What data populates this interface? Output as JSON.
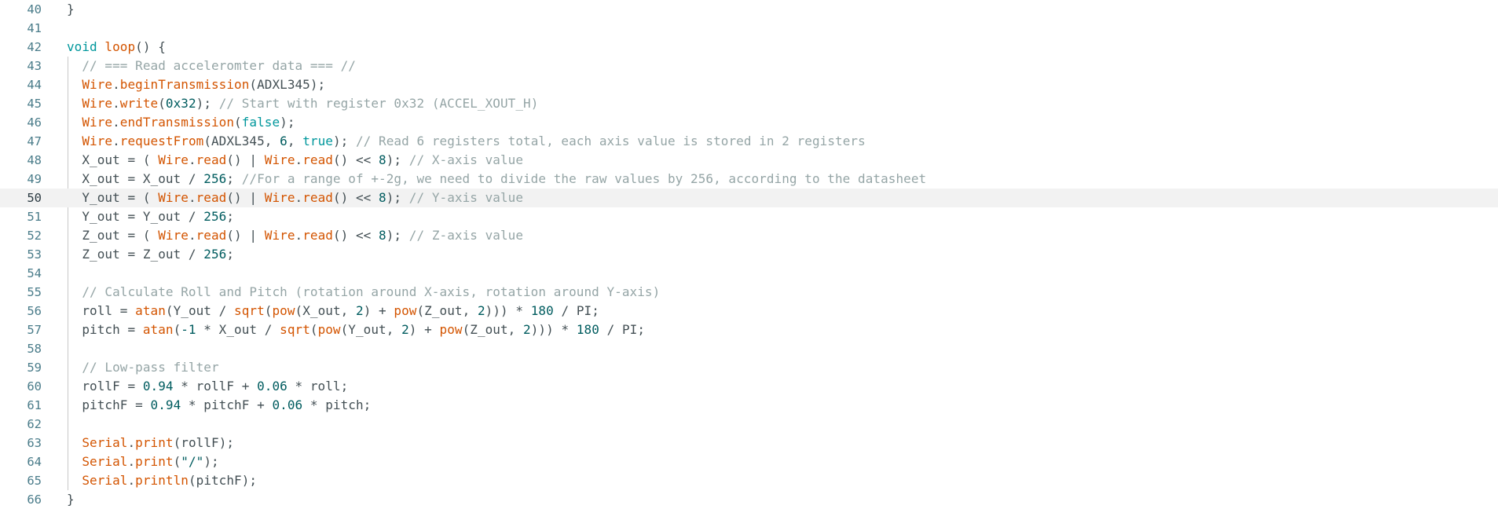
{
  "editor": {
    "active_line": 50,
    "lines": [
      {
        "n": "40",
        "tokens": [
          [
            "txt",
            "}"
          ]
        ]
      },
      {
        "n": "41",
        "tokens": []
      },
      {
        "n": "42",
        "tokens": [
          [
            "kw",
            "void"
          ],
          [
            "txt",
            " "
          ],
          [
            "fn",
            "loop"
          ],
          [
            "txt",
            "() {"
          ]
        ]
      },
      {
        "n": "43",
        "tokens": [
          [
            "txt",
            "  "
          ],
          [
            "com",
            "// === Read acceleromter data === //"
          ]
        ]
      },
      {
        "n": "44",
        "tokens": [
          [
            "txt",
            "  "
          ],
          [
            "obj",
            "Wire"
          ],
          [
            "txt",
            "."
          ],
          [
            "fn",
            "beginTransmission"
          ],
          [
            "txt",
            "(ADXL345);"
          ]
        ]
      },
      {
        "n": "45",
        "tokens": [
          [
            "txt",
            "  "
          ],
          [
            "obj",
            "Wire"
          ],
          [
            "txt",
            "."
          ],
          [
            "fn",
            "write"
          ],
          [
            "txt",
            "("
          ],
          [
            "num",
            "0x32"
          ],
          [
            "txt",
            "); "
          ],
          [
            "com",
            "// Start with register 0x32 (ACCEL_XOUT_H)"
          ]
        ]
      },
      {
        "n": "46",
        "tokens": [
          [
            "txt",
            "  "
          ],
          [
            "obj",
            "Wire"
          ],
          [
            "txt",
            "."
          ],
          [
            "fn",
            "endTransmission"
          ],
          [
            "txt",
            "("
          ],
          [
            "kw",
            "false"
          ],
          [
            "txt",
            ");"
          ]
        ]
      },
      {
        "n": "47",
        "tokens": [
          [
            "txt",
            "  "
          ],
          [
            "obj",
            "Wire"
          ],
          [
            "txt",
            "."
          ],
          [
            "fn",
            "requestFrom"
          ],
          [
            "txt",
            "(ADXL345, "
          ],
          [
            "num",
            "6"
          ],
          [
            "txt",
            ", "
          ],
          [
            "kw",
            "true"
          ],
          [
            "txt",
            "); "
          ],
          [
            "com",
            "// Read 6 registers total, each axis value is stored in 2 registers"
          ]
        ]
      },
      {
        "n": "48",
        "tokens": [
          [
            "txt",
            "  X_out = ( "
          ],
          [
            "obj",
            "Wire"
          ],
          [
            "txt",
            "."
          ],
          [
            "fn",
            "read"
          ],
          [
            "txt",
            "() | "
          ],
          [
            "obj",
            "Wire"
          ],
          [
            "txt",
            "."
          ],
          [
            "fn",
            "read"
          ],
          [
            "txt",
            "() << "
          ],
          [
            "num",
            "8"
          ],
          [
            "txt",
            "); "
          ],
          [
            "com",
            "// X-axis value"
          ]
        ]
      },
      {
        "n": "49",
        "tokens": [
          [
            "txt",
            "  X_out = X_out / "
          ],
          [
            "num",
            "256"
          ],
          [
            "txt",
            "; "
          ],
          [
            "com",
            "//For a range of +-2g, we need to divide the raw values by 256, according to the datasheet"
          ]
        ]
      },
      {
        "n": "50",
        "tokens": [
          [
            "txt",
            "  Y_out = ( "
          ],
          [
            "obj",
            "Wire"
          ],
          [
            "txt",
            "."
          ],
          [
            "fn",
            "read"
          ],
          [
            "txt",
            "() | "
          ],
          [
            "obj",
            "Wire"
          ],
          [
            "txt",
            "."
          ],
          [
            "fn",
            "read"
          ],
          [
            "txt",
            "() << "
          ],
          [
            "num",
            "8"
          ],
          [
            "txt",
            "); "
          ],
          [
            "com",
            "// Y-axis value"
          ]
        ]
      },
      {
        "n": "51",
        "tokens": [
          [
            "txt",
            "  Y_out = Y_out / "
          ],
          [
            "num",
            "256"
          ],
          [
            "txt",
            ";"
          ]
        ]
      },
      {
        "n": "52",
        "tokens": [
          [
            "txt",
            "  Z_out = ( "
          ],
          [
            "obj",
            "Wire"
          ],
          [
            "txt",
            "."
          ],
          [
            "fn",
            "read"
          ],
          [
            "txt",
            "() | "
          ],
          [
            "obj",
            "Wire"
          ],
          [
            "txt",
            "."
          ],
          [
            "fn",
            "read"
          ],
          [
            "txt",
            "() << "
          ],
          [
            "num",
            "8"
          ],
          [
            "txt",
            "); "
          ],
          [
            "com",
            "// Z-axis value"
          ]
        ]
      },
      {
        "n": "53",
        "tokens": [
          [
            "txt",
            "  Z_out = Z_out / "
          ],
          [
            "num",
            "256"
          ],
          [
            "txt",
            ";"
          ]
        ]
      },
      {
        "n": "54",
        "tokens": []
      },
      {
        "n": "55",
        "tokens": [
          [
            "txt",
            "  "
          ],
          [
            "com",
            "// Calculate Roll and Pitch (rotation around X-axis, rotation around Y-axis)"
          ]
        ]
      },
      {
        "n": "56",
        "tokens": [
          [
            "txt",
            "  roll = "
          ],
          [
            "fn",
            "atan"
          ],
          [
            "txt",
            "(Y_out / "
          ],
          [
            "fn",
            "sqrt"
          ],
          [
            "txt",
            "("
          ],
          [
            "fn",
            "pow"
          ],
          [
            "txt",
            "(X_out, "
          ],
          [
            "num",
            "2"
          ],
          [
            "txt",
            ") + "
          ],
          [
            "fn",
            "pow"
          ],
          [
            "txt",
            "(Z_out, "
          ],
          [
            "num",
            "2"
          ],
          [
            "txt",
            "))) * "
          ],
          [
            "num",
            "180"
          ],
          [
            "txt",
            " / PI;"
          ]
        ]
      },
      {
        "n": "57",
        "tokens": [
          [
            "txt",
            "  pitch = "
          ],
          [
            "fn",
            "atan"
          ],
          [
            "txt",
            "("
          ],
          [
            "num",
            "-1"
          ],
          [
            "txt",
            " * X_out / "
          ],
          [
            "fn",
            "sqrt"
          ],
          [
            "txt",
            "("
          ],
          [
            "fn",
            "pow"
          ],
          [
            "txt",
            "(Y_out, "
          ],
          [
            "num",
            "2"
          ],
          [
            "txt",
            ") + "
          ],
          [
            "fn",
            "pow"
          ],
          [
            "txt",
            "(Z_out, "
          ],
          [
            "num",
            "2"
          ],
          [
            "txt",
            "))) * "
          ],
          [
            "num",
            "180"
          ],
          [
            "txt",
            " / PI;"
          ]
        ]
      },
      {
        "n": "58",
        "tokens": []
      },
      {
        "n": "59",
        "tokens": [
          [
            "txt",
            "  "
          ],
          [
            "com",
            "// Low-pass filter"
          ]
        ]
      },
      {
        "n": "60",
        "tokens": [
          [
            "txt",
            "  rollF = "
          ],
          [
            "num",
            "0.94"
          ],
          [
            "txt",
            " * rollF + "
          ],
          [
            "num",
            "0.06"
          ],
          [
            "txt",
            " * roll;"
          ]
        ]
      },
      {
        "n": "61",
        "tokens": [
          [
            "txt",
            "  pitchF = "
          ],
          [
            "num",
            "0.94"
          ],
          [
            "txt",
            " * pitchF + "
          ],
          [
            "num",
            "0.06"
          ],
          [
            "txt",
            " * pitch;"
          ]
        ]
      },
      {
        "n": "62",
        "tokens": []
      },
      {
        "n": "63",
        "tokens": [
          [
            "txt",
            "  "
          ],
          [
            "obj",
            "Serial"
          ],
          [
            "txt",
            "."
          ],
          [
            "fn",
            "print"
          ],
          [
            "txt",
            "(rollF);"
          ]
        ]
      },
      {
        "n": "64",
        "tokens": [
          [
            "txt",
            "  "
          ],
          [
            "obj",
            "Serial"
          ],
          [
            "txt",
            "."
          ],
          [
            "fn",
            "print"
          ],
          [
            "txt",
            "("
          ],
          [
            "str",
            "\"/\""
          ],
          [
            "txt",
            ");"
          ]
        ]
      },
      {
        "n": "65",
        "tokens": [
          [
            "txt",
            "  "
          ],
          [
            "obj",
            "Serial"
          ],
          [
            "txt",
            "."
          ],
          [
            "fn",
            "println"
          ],
          [
            "txt",
            "(pitchF);"
          ]
        ]
      },
      {
        "n": "66",
        "tokens": [
          [
            "txt",
            "}"
          ]
        ]
      }
    ]
  }
}
